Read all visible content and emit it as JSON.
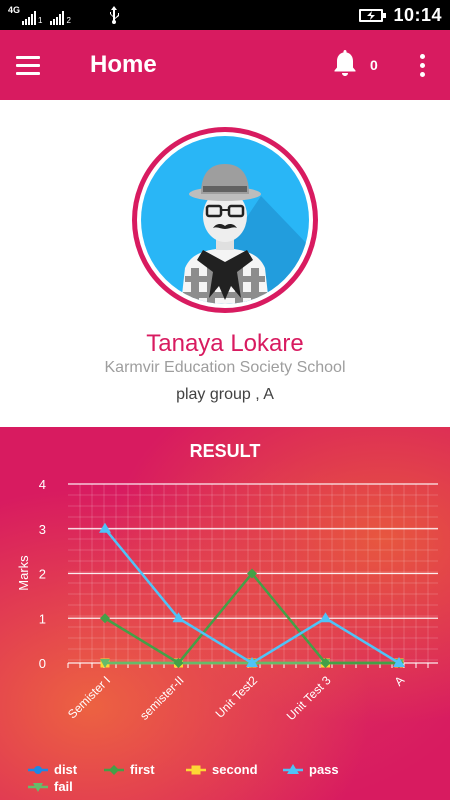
{
  "status_bar": {
    "network": "4G",
    "sim1": "1",
    "sim2": "2",
    "time": "10:14"
  },
  "app_bar": {
    "title": "Home",
    "notification_count": "0"
  },
  "profile": {
    "name": "Tanaya Lokare",
    "school": "Karmvir Education Society School",
    "class": "play group , A"
  },
  "colors": {
    "primary": "#d81b60",
    "dist": "#1e88e5",
    "first": "#43a047",
    "second": "#fdd835",
    "pass": "#4fc3f7",
    "fail": "#66bb6a"
  },
  "result": {
    "title": "RESULT"
  },
  "chart_data": {
    "type": "line",
    "title": "RESULT",
    "xlabel": "",
    "ylabel": "Marks",
    "categories": [
      "Semister I",
      "semister-II",
      "Unit Test2",
      "Unit Test 3",
      "A"
    ],
    "ylim": [
      0,
      4
    ],
    "yticks": [
      0,
      1,
      2,
      3,
      4
    ],
    "grid": true,
    "legend_position": "bottom",
    "series": [
      {
        "name": "dist",
        "color": "#1e88e5",
        "marker": "circle",
        "values": [
          0,
          0,
          0,
          0,
          0
        ]
      },
      {
        "name": "first",
        "color": "#43a047",
        "marker": "diamond",
        "values": [
          1,
          0,
          2,
          0,
          0
        ]
      },
      {
        "name": "second",
        "color": "#fdd835",
        "marker": "square",
        "values": [
          0,
          0,
          0,
          0,
          0
        ]
      },
      {
        "name": "pass",
        "color": "#4fc3f7",
        "marker": "triangle",
        "values": [
          3,
          1,
          0,
          1,
          0
        ]
      },
      {
        "name": "fail",
        "color": "#66bb6a",
        "marker": "triangle-down",
        "values": [
          0,
          0,
          0,
          0,
          0
        ]
      }
    ]
  }
}
